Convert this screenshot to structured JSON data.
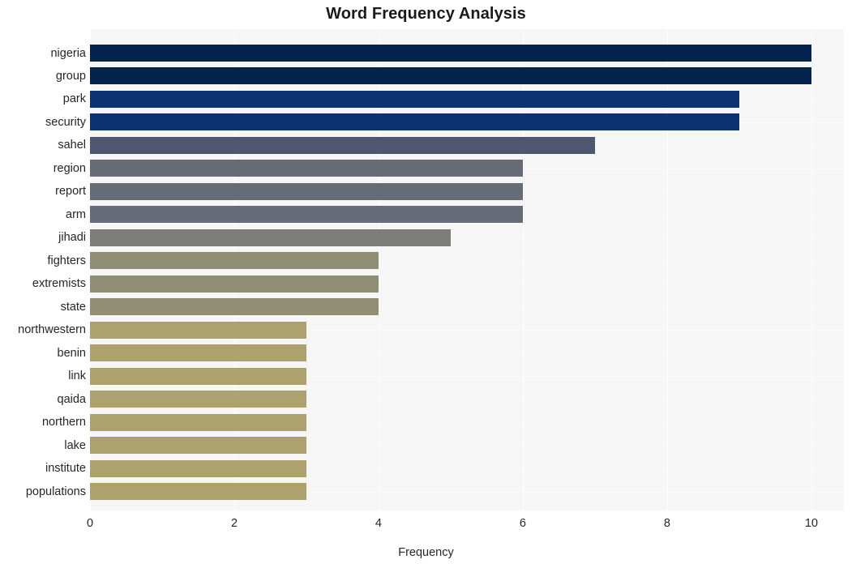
{
  "chart_data": {
    "type": "bar",
    "orientation": "horizontal",
    "title": "Word Frequency Analysis",
    "xlabel": "Frequency",
    "ylabel": "",
    "xlim": [
      0,
      10.45
    ],
    "xticks": [
      0,
      2,
      4,
      6,
      8,
      10
    ],
    "xtick_labels": [
      "0",
      "2",
      "4",
      "6",
      "8",
      "10"
    ],
    "grid": true,
    "grid_axis": "x",
    "legend": null,
    "categories": [
      "nigeria",
      "group",
      "park",
      "security",
      "sahel",
      "region",
      "report",
      "arm",
      "jihadi",
      "fighters",
      "extremists",
      "state",
      "northwestern",
      "benin",
      "link",
      "qaida",
      "northern",
      "lake",
      "institute",
      "populations"
    ],
    "values": [
      10,
      10,
      9,
      9,
      7,
      6,
      6,
      6,
      5,
      4,
      4,
      4,
      3,
      3,
      3,
      3,
      3,
      3,
      3,
      3
    ],
    "bar_colors": [
      "#04244f",
      "#04244f",
      "#0c3272",
      "#0c3272",
      "#4e5670",
      "#666b78",
      "#666b78",
      "#666b78",
      "#7c7c78",
      "#918e76",
      "#918e76",
      "#918e76",
      "#ada16e",
      "#ada16e",
      "#ada16e",
      "#ada16e",
      "#ada16e",
      "#ada16e",
      "#ada16e",
      "#ada16e"
    ],
    "plot_background": "#f6f6f7",
    "figure_background": "#ffffff",
    "gridline_color": "#ffffff",
    "text_color": "#262626"
  }
}
